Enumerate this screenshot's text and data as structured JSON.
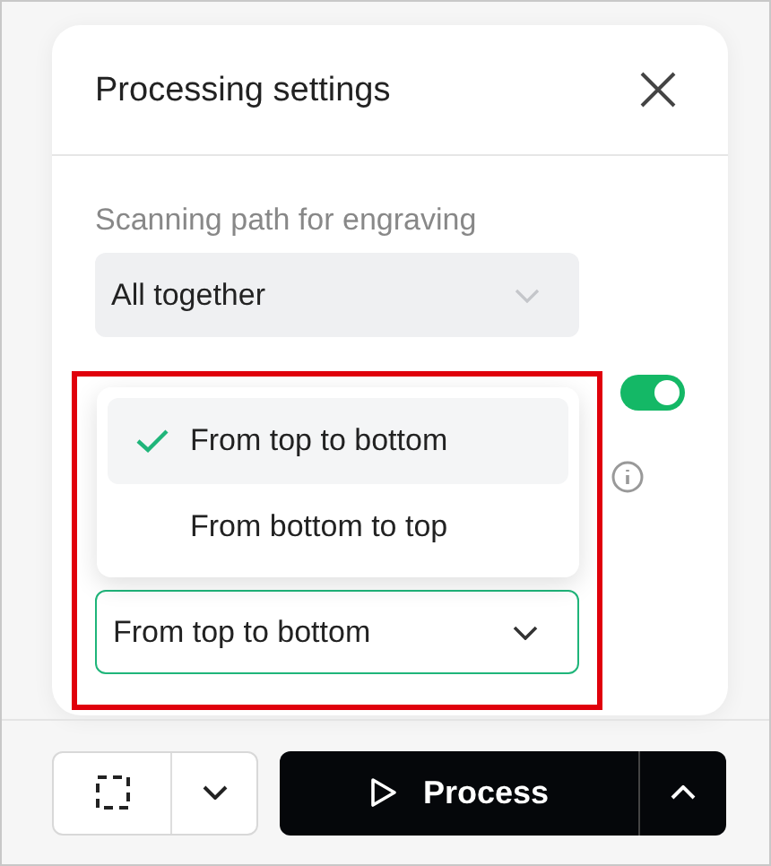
{
  "panel": {
    "title": "Processing settings"
  },
  "scanning_path": {
    "label": "Scanning path for engraving",
    "value": "All together"
  },
  "toggle": {
    "on": true
  },
  "direction_menu": {
    "items": [
      {
        "label": "From top to bottom",
        "selected": true
      },
      {
        "label": "From bottom to top",
        "selected": false
      }
    ]
  },
  "direction_select": {
    "value": "From top to bottom",
    "focused": true
  },
  "process_button": {
    "label": "Process"
  }
}
